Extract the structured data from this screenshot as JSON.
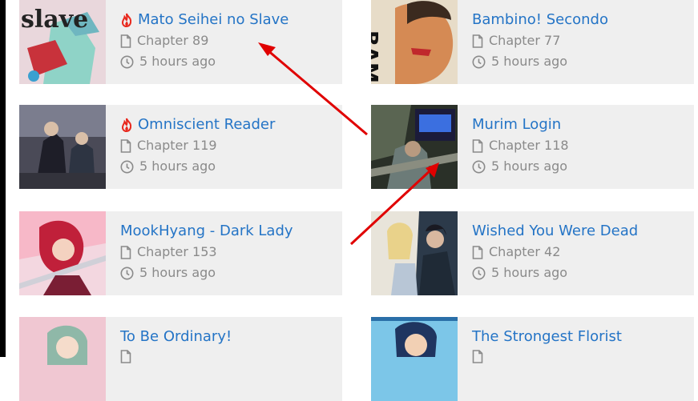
{
  "accent_color": "#2474c6",
  "hot_color": "#e8271c",
  "annotation_color": "#e00000",
  "cards": [
    {
      "title": "Mato Seihei no Slave",
      "chapter": "Chapter 89",
      "time": "5 hours ago",
      "hot": true,
      "cover_text": "slave"
    },
    {
      "title": "Bambino! Secondo",
      "chapter": "Chapter 77",
      "time": "5 hours ago",
      "hot": false,
      "cover_text": "BAMBI"
    },
    {
      "title": "Omniscient Reader",
      "chapter": "Chapter 119",
      "time": "5 hours ago",
      "hot": true
    },
    {
      "title": "Murim Login",
      "chapter": "Chapter 118",
      "time": "5 hours ago",
      "hot": false
    },
    {
      "title": "MookHyang - Dark Lady",
      "chapter": "Chapter 153",
      "time": "5 hours ago",
      "hot": false
    },
    {
      "title": "Wished You Were Dead",
      "chapter": "Chapter 42",
      "time": "5 hours ago",
      "hot": false
    },
    {
      "title": "To Be Ordinary!",
      "chapter": "",
      "time": "",
      "hot": false
    },
    {
      "title": "The Strongest Florist",
      "chapter": "",
      "time": "",
      "hot": false
    }
  ]
}
